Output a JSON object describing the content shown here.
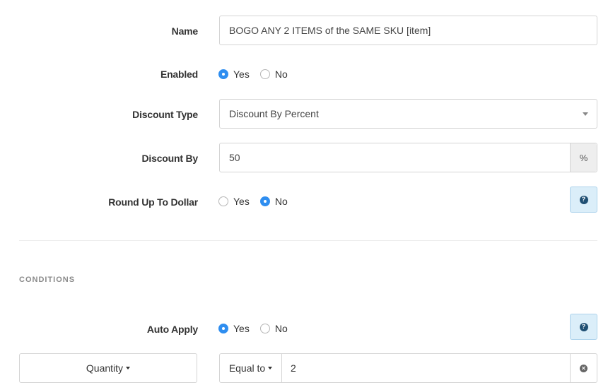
{
  "name": {
    "label": "Name",
    "value": "BOGO ANY 2 ITEMS of the SAME SKU [item]"
  },
  "enabled": {
    "label": "Enabled",
    "options": [
      {
        "label": "Yes",
        "checked": true
      },
      {
        "label": "No",
        "checked": false
      }
    ]
  },
  "discount_type": {
    "label": "Discount Type",
    "selected": "Discount By Percent"
  },
  "discount_by": {
    "label": "Discount By",
    "value": "50",
    "addon": "%"
  },
  "round_up": {
    "label": "Round Up To Dollar",
    "options": [
      {
        "label": "Yes",
        "checked": false
      },
      {
        "label": "No",
        "checked": true
      }
    ],
    "help_icon": "?"
  },
  "conditions": {
    "title": "CONDITIONS",
    "auto_apply": {
      "label": "Auto Apply",
      "options": [
        {
          "label": "Yes",
          "checked": true
        },
        {
          "label": "No",
          "checked": false
        }
      ],
      "help_icon": "?"
    },
    "condition_row": {
      "field_label": "Quantity",
      "operator_label": "Equal to",
      "value": "2"
    }
  },
  "colors": {
    "accent": "#2f8ef0",
    "help_bg": "#dbeef9",
    "help_icon": "#1f4f73"
  }
}
